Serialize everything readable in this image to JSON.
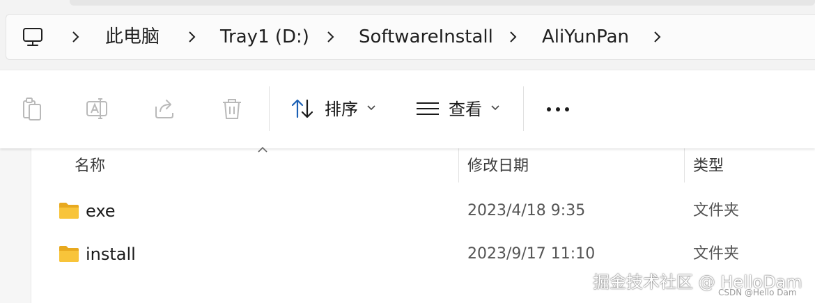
{
  "breadcrumb": {
    "items": [
      "此电脑",
      "Tray1 (D:)",
      "SoftwareInstall",
      "AliYunPan"
    ],
    "root_icon": "computer-icon",
    "separator_icon": "chevron-right-icon"
  },
  "toolbar": {
    "copy_icon": "copy-icon",
    "rename_icon": "rename-icon",
    "share_icon": "share-icon",
    "delete_icon": "trash-icon",
    "sort_label": "排序",
    "view_label": "查看",
    "more_icon": "more-horizontal-icon"
  },
  "columns": {
    "name": "名称",
    "date": "修改日期",
    "type": "类型"
  },
  "files": [
    {
      "name": "exe",
      "date": "2023/4/18 9:35",
      "type": "文件夹",
      "icon": "folder-icon"
    },
    {
      "name": "install",
      "date": "2023/9/17 11:10",
      "type": "文件夹",
      "icon": "folder-icon"
    }
  ],
  "watermark": {
    "main": "掘金技术社区 @ HelloDam",
    "sub": "CSDN @Hello Dam"
  },
  "colors": {
    "accent": "#0067c0",
    "folder": "#f8c43a"
  }
}
